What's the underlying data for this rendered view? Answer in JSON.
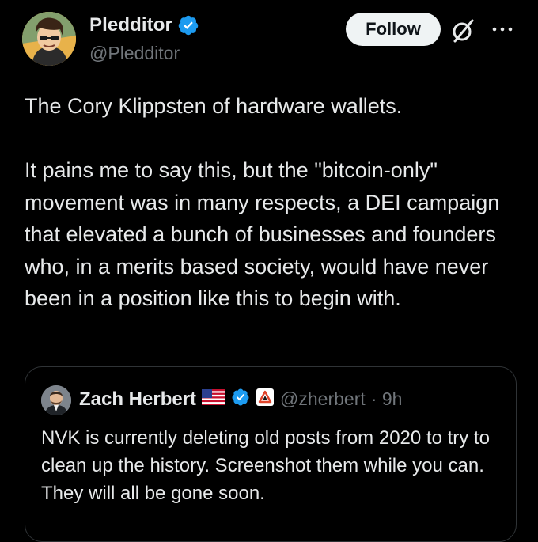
{
  "author": {
    "display_name": "Pledditor",
    "handle": "@Pledditor",
    "verified": true
  },
  "actions": {
    "follow_label": "Follow",
    "grok_icon": "grok-icon",
    "more_icon": "more-horizontal-icon"
  },
  "post": {
    "paragraph_1": "The Cory Klippsten of hardware wallets.",
    "paragraph_2": "It pains me to say this, but the \"bitcoin-only\" movement was in many respects, a DEI campaign that elevated a bunch of businesses and founders who, in a merits based society, would have never been in a position like this to begin with."
  },
  "quoted_post": {
    "display_name": "Zach Herbert",
    "handle": "@zherbert",
    "time": "· 9h",
    "flag": "us-flag-icon",
    "verified": true,
    "affiliate_badge": "affiliate-badge-icon",
    "text": "NVK is currently deleting old posts from 2020 to try to clean up the history. Screenshot them while you can. They will all be gone soon."
  },
  "colors": {
    "background": "#000000",
    "text": "#e7e9ea",
    "secondary_text": "#71767b",
    "verified_blue": "#1d9bf0",
    "border": "#2f3336",
    "follow_bg": "#eff3f4"
  }
}
